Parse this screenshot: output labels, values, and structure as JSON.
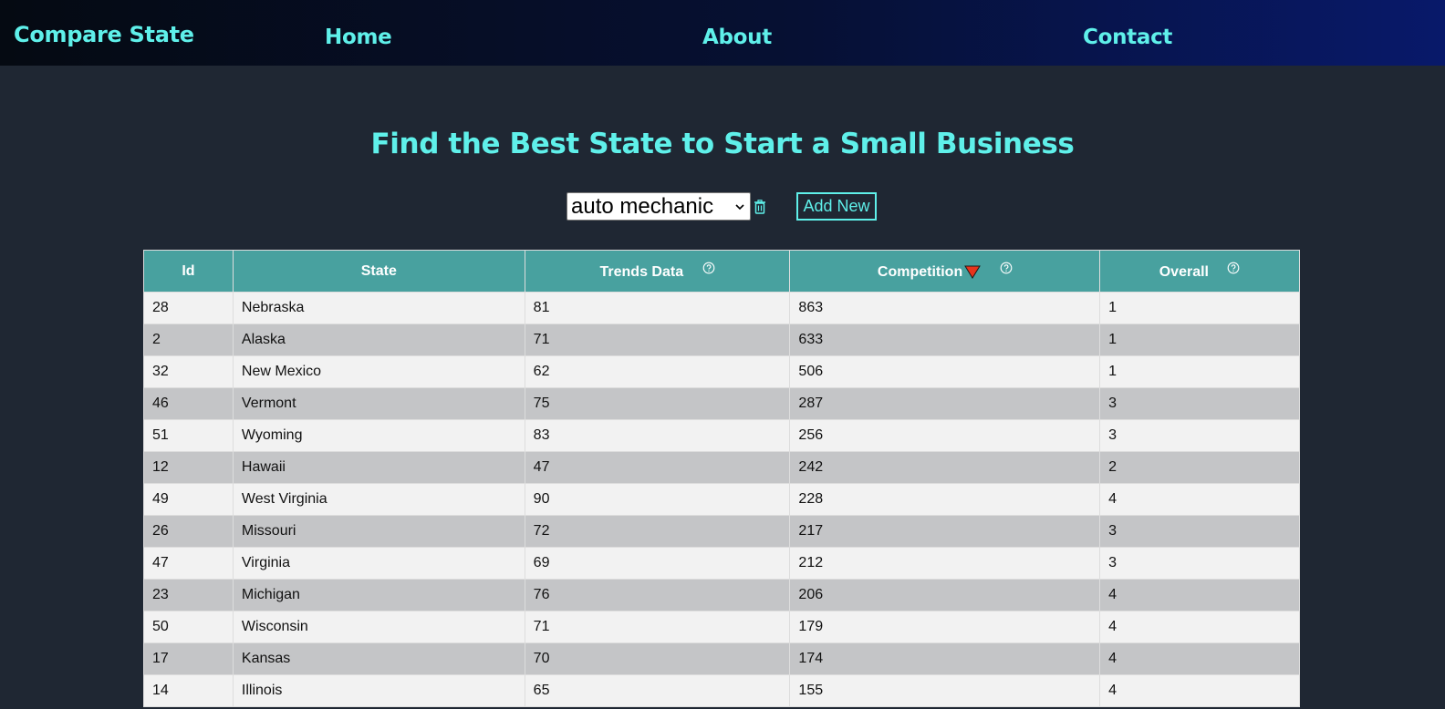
{
  "nav": {
    "brand": "Compare State",
    "home": "Home",
    "about": "About",
    "contact": "Contact"
  },
  "page": {
    "title": "Find the Best State to Start a Small Business"
  },
  "controls": {
    "selected_business": "auto mechanic",
    "add_label": "Add New"
  },
  "colors": {
    "accent": "#5ff0ea",
    "header_bg": "#48a19f",
    "sort_indicator": "#e8341c"
  },
  "table": {
    "headers": {
      "id": "Id",
      "state": "State",
      "trends": "Trends Data",
      "competition": "Competition",
      "overall": "Overall"
    },
    "sort": {
      "column": "Competition",
      "direction": "descending"
    },
    "rows": [
      {
        "id": "28",
        "state": "Nebraska",
        "trends": "81",
        "competition": "863",
        "overall": "1"
      },
      {
        "id": "2",
        "state": "Alaska",
        "trends": "71",
        "competition": "633",
        "overall": "1"
      },
      {
        "id": "32",
        "state": "New Mexico",
        "trends": "62",
        "competition": "506",
        "overall": "1"
      },
      {
        "id": "46",
        "state": "Vermont",
        "trends": "75",
        "competition": "287",
        "overall": "3"
      },
      {
        "id": "51",
        "state": "Wyoming",
        "trends": "83",
        "competition": "256",
        "overall": "3"
      },
      {
        "id": "12",
        "state": "Hawaii",
        "trends": "47",
        "competition": "242",
        "overall": "2"
      },
      {
        "id": "49",
        "state": "West Virginia",
        "trends": "90",
        "competition": "228",
        "overall": "4"
      },
      {
        "id": "26",
        "state": "Missouri",
        "trends": "72",
        "competition": "217",
        "overall": "3"
      },
      {
        "id": "47",
        "state": "Virginia",
        "trends": "69",
        "competition": "212",
        "overall": "3"
      },
      {
        "id": "23",
        "state": "Michigan",
        "trends": "76",
        "competition": "206",
        "overall": "4"
      },
      {
        "id": "50",
        "state": "Wisconsin",
        "trends": "71",
        "competition": "179",
        "overall": "4"
      },
      {
        "id": "17",
        "state": "Kansas",
        "trends": "70",
        "competition": "174",
        "overall": "4"
      },
      {
        "id": "14",
        "state": "Illinois",
        "trends": "65",
        "competition": "155",
        "overall": "4"
      }
    ]
  }
}
